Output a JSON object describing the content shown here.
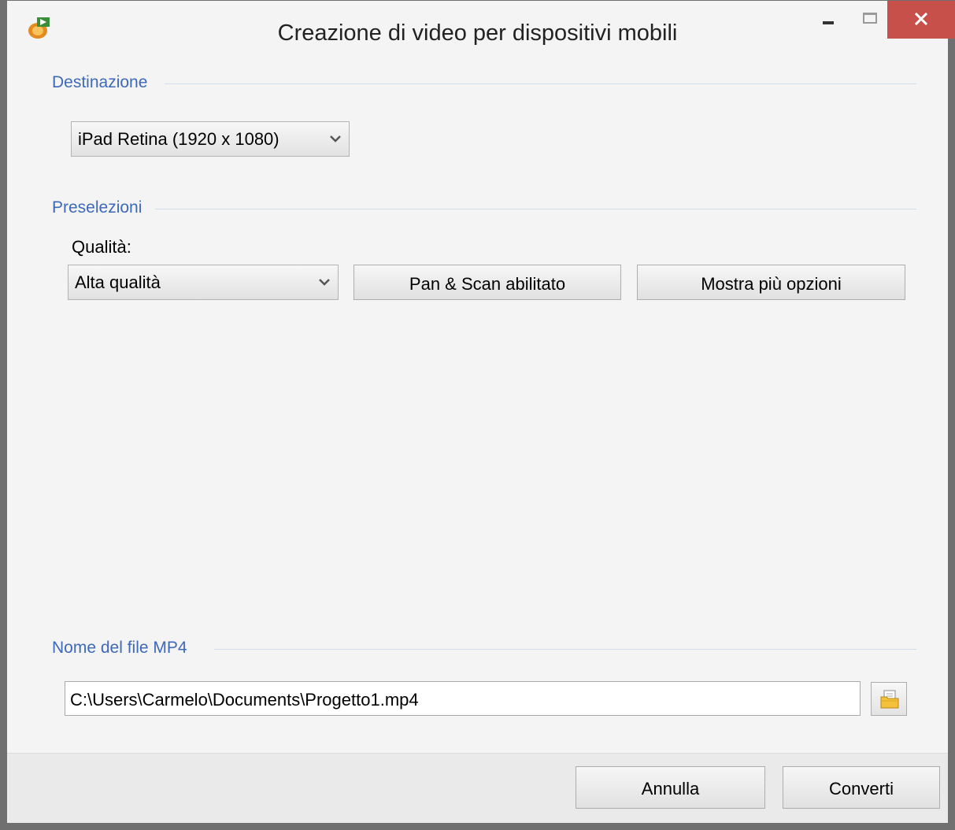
{
  "window": {
    "title": "Creazione di video per dispositivi mobili"
  },
  "destination": {
    "group_label": "Destinazione",
    "device_selected": "iPad Retina (1920 x 1080)"
  },
  "presets": {
    "group_label": "Preselezioni",
    "quality_label": "Qualità:",
    "quality_selected": "Alta qualità",
    "pan_scan_button": "Pan & Scan abilitato",
    "more_options_button": "Mostra più opzioni"
  },
  "file": {
    "group_label": "Nome del file MP4",
    "path": "C:\\Users\\Carmelo\\Documents\\Progetto1.mp4"
  },
  "footer": {
    "cancel_label": "Annulla",
    "convert_label": "Converti"
  },
  "colors": {
    "group_label": "#3e69b9",
    "close_button": "#c7504b"
  },
  "icons": {
    "app": "app-icon",
    "minimize": "minimize-icon",
    "maximize": "maximize-icon",
    "close": "close-icon",
    "dropdown": "chevron-down-icon",
    "browse": "folder-icon"
  }
}
